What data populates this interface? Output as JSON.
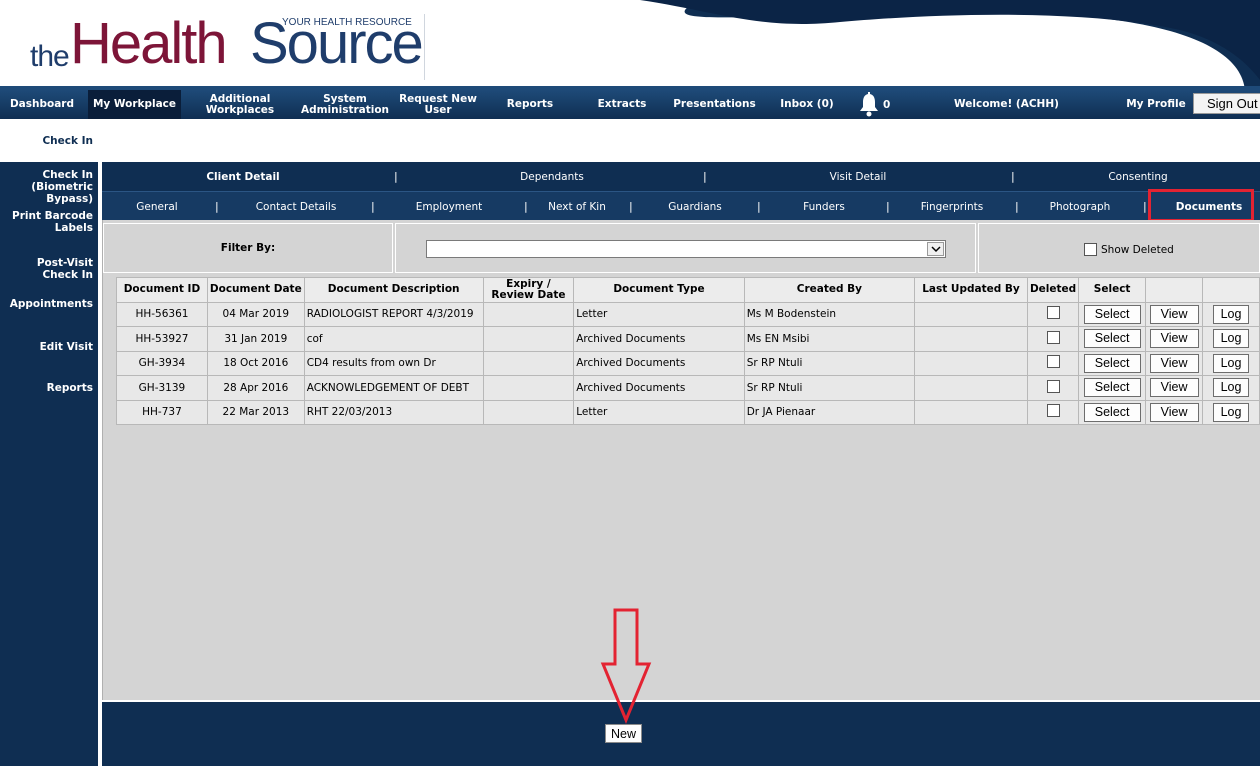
{
  "header": {
    "logo_the": "the",
    "logo_health": "Health",
    "logo_source": "Source",
    "tagline": "YOUR HEALTH RESOURCE"
  },
  "nav": {
    "dashboard": "Dashboard",
    "my_workplace": "My Workplace",
    "additional_workplaces": "Additional Workplaces",
    "system_administration": "System Administration",
    "request_new_user": "Request New User",
    "reports": "Reports",
    "extracts": "Extracts",
    "presentations": "Presentations",
    "inbox": "Inbox (0)",
    "notifications_count": "0",
    "welcome": "Welcome! (ACHH)",
    "my_profile": "My Profile",
    "sign_out": "Sign Out"
  },
  "page_title": "Check In",
  "sidebar": {
    "check_in_biometric": "Check In (Biometric Bypass)",
    "print_barcode": "Print Barcode Labels",
    "post_visit": "Post-Visit Check In",
    "appointments": "Appointments",
    "edit_visit": "Edit Visit",
    "reports": "Reports"
  },
  "tabs_primary": {
    "client_detail": "Client Detail",
    "dependants": "Dependants",
    "visit_detail": "Visit Detail",
    "consenting": "Consenting"
  },
  "tabs_secondary": {
    "general": "General",
    "contact_details": "Contact Details",
    "employment": "Employment",
    "next_of_kin": "Next of Kin",
    "guardians": "Guardians",
    "funders": "Funders",
    "fingerprints": "Fingerprints",
    "photograph": "Photograph",
    "documents": "Documents"
  },
  "separator": "|",
  "filter": {
    "label": "Filter By:",
    "selected": "",
    "show_deleted_label": "Show Deleted"
  },
  "table": {
    "headers": {
      "document_id": "Document ID",
      "document_date": "Document Date",
      "document_description": "Document Description",
      "expiry": "Expiry / Review Date",
      "document_type": "Document Type",
      "created_by": "Created By",
      "last_updated_by": "Last Updated By",
      "deleted": "Deleted",
      "select": "Select"
    },
    "rows": [
      {
        "id": "HH-56361",
        "date": "04 Mar 2019",
        "description": "RADIOLOGIST REPORT 4/3/2019",
        "expiry": "",
        "type": "Letter",
        "created_by": "Ms M Bodenstein",
        "last_updated_by": ""
      },
      {
        "id": "HH-53927",
        "date": "31 Jan 2019",
        "description": "cof",
        "expiry": "",
        "type": "Archived Documents",
        "created_by": "Ms EN Msibi",
        "last_updated_by": ""
      },
      {
        "id": "GH-3934",
        "date": "18 Oct 2016",
        "description": "CD4 results from own Dr",
        "expiry": "",
        "type": "Archived Documents",
        "created_by": "Sr RP Ntuli",
        "last_updated_by": ""
      },
      {
        "id": "GH-3139",
        "date": "28 Apr 2016",
        "description": "ACKNOWLEDGEMENT OF DEBT",
        "expiry": "",
        "type": "Archived Documents",
        "created_by": "Sr RP Ntuli",
        "last_updated_by": ""
      },
      {
        "id": "HH-737",
        "date": "22 Mar 2013",
        "description": "RHT 22/03/2013",
        "expiry": "",
        "type": "Letter",
        "created_by": "Dr JA Pienaar",
        "last_updated_by": ""
      }
    ],
    "button_select": "Select",
    "button_view": "View",
    "button_log": "Log"
  },
  "footer": {
    "new_button": "New"
  },
  "colors": {
    "navy": "#0f2e52",
    "highlight": "#e32332",
    "brand_red": "#7d1538"
  }
}
